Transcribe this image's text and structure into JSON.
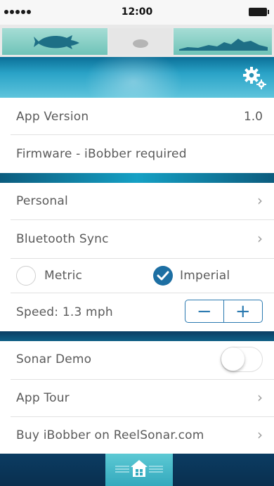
{
  "status_bar": {
    "time": "12:00"
  },
  "settings": {
    "app_version": {
      "label": "App Version",
      "value": "1.0"
    },
    "firmware": {
      "label": "Firmware - iBobber required"
    },
    "personal": {
      "label": "Personal"
    },
    "bluetooth_sync": {
      "label": "Bluetooth Sync"
    },
    "units": {
      "metric_label": "Metric",
      "imperial_label": "Imperial",
      "selected": "Imperial"
    },
    "speed": {
      "label": "Speed: 1.3 mph",
      "minus": "−",
      "plus": "+"
    },
    "sonar_demo": {
      "label": "Sonar Demo",
      "enabled": false
    },
    "app_tour": {
      "label": "App Tour"
    },
    "buy": {
      "label": "Buy iBobber on ReelSonar.com"
    },
    "chevron": "›"
  },
  "icons": {
    "tab_left": "fish-icon",
    "tab_mid": "bobber-icon",
    "tab_right": "terrain-icon",
    "settings": "gears-icon",
    "home": "home-icon"
  },
  "colors": {
    "accent_blue": "#2a79b0",
    "teal_tab": "#6fc3b8",
    "nav_dark": "#0a2f4f",
    "home_tab": "#34a9bd"
  }
}
